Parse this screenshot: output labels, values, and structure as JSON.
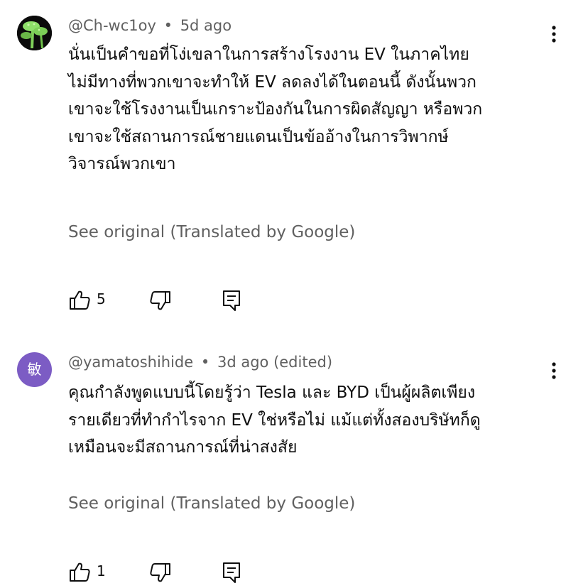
{
  "comments": [
    {
      "author": "@Ch-wc1oy",
      "separator": "•",
      "time": "5d ago",
      "edited": "",
      "lines": [
        "นั่นเป็นคำขอที่โง่เขลาในการสร้างโรงงาน EV ในภาคไทย",
        "ไม่มีทางที่พวกเขาจะทำให้ EV ลดลงได้ในตอนนี้ ดังนั้นพวก",
        "เขาจะใช้โรงงานเป็นเกราะป้องกันในการผิดสัญญา หรือพวก",
        "เขาจะใช้สถานการณ์ชายแดนเป็นข้ออ้างในการวิพากษ์",
        "วิจารณ์พวกเขา"
      ],
      "see_original": "See original (Translated by Google)",
      "likes": "5",
      "avatar_icon": "green-mushroom-icon"
    },
    {
      "author": "@yamatoshihide",
      "separator": "•",
      "time": "3d ago",
      "edited": "(edited)",
      "avatar_letter": "敏",
      "avatar_color": "#7c5cc4",
      "lines": [
        "คุณกำลังพูดแบบนี้โดยรู้ว่า Tesla และ BYD เป็นผู้ผลิตเพียง",
        "รายเดียวที่ทำกำไรจาก EV ใช่หรือไม่ แม้แต่ทั้งสองบริษัทก็ดู",
        "เหมือนจะมีสถานการณ์ที่น่าสงสัย"
      ],
      "see_original": "See original (Translated by Google)",
      "likes": "1"
    }
  ],
  "icons": {
    "like": "thumbs-up-icon",
    "dislike": "thumbs-down-icon",
    "reply": "reply-icon",
    "more": "more-vertical-icon"
  }
}
